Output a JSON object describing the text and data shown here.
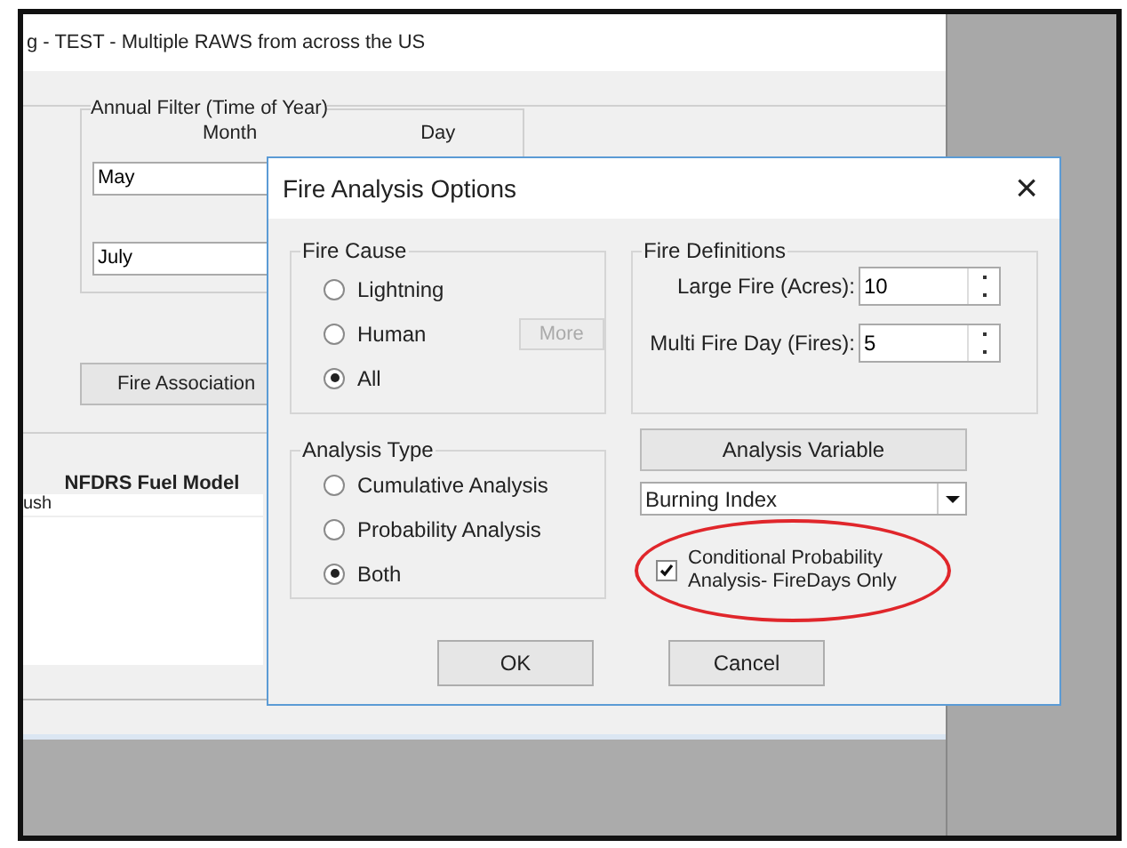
{
  "background_window": {
    "title": "g - TEST - Multiple RAWS from across the US",
    "annual_filter": {
      "title": "Annual Filter (Time of Year)",
      "month_label": "Month",
      "day_label": "Day",
      "start_month": "May",
      "end_month": "July"
    },
    "fire_association_button": "Fire Association",
    "table": {
      "columns": [
        "NFDRS Fuel Model"
      ],
      "rows": [
        [
          "ush"
        ]
      ]
    }
  },
  "dialog": {
    "title": "Fire Analysis Options",
    "close": "×",
    "fire_cause": {
      "title": "Fire Cause",
      "options": [
        {
          "label": "Lightning",
          "selected": false
        },
        {
          "label": "Human",
          "selected": false
        },
        {
          "label": "All",
          "selected": true
        }
      ],
      "more_button": {
        "label": "More",
        "disabled": true
      }
    },
    "analysis_type": {
      "title": "Analysis Type",
      "options": [
        {
          "label": "Cumulative Analysis",
          "selected": false
        },
        {
          "label": "Probability Analysis",
          "selected": false
        },
        {
          "label": "Both",
          "selected": true
        }
      ]
    },
    "fire_definitions": {
      "title": "Fire Definitions",
      "fields": [
        {
          "label": "Large Fire (Acres):",
          "value": "10"
        },
        {
          "label": "Multi Fire Day (Fires):",
          "value": "5"
        }
      ]
    },
    "analysis_variable_button": "Analysis Variable",
    "variable_select": {
      "value": "Burning Index"
    },
    "conditional_checkbox": {
      "label": "Conditional Probability Analysis- FireDays Only",
      "checked": true,
      "highlighted": true
    },
    "buttons": [
      "OK",
      "Cancel"
    ]
  }
}
